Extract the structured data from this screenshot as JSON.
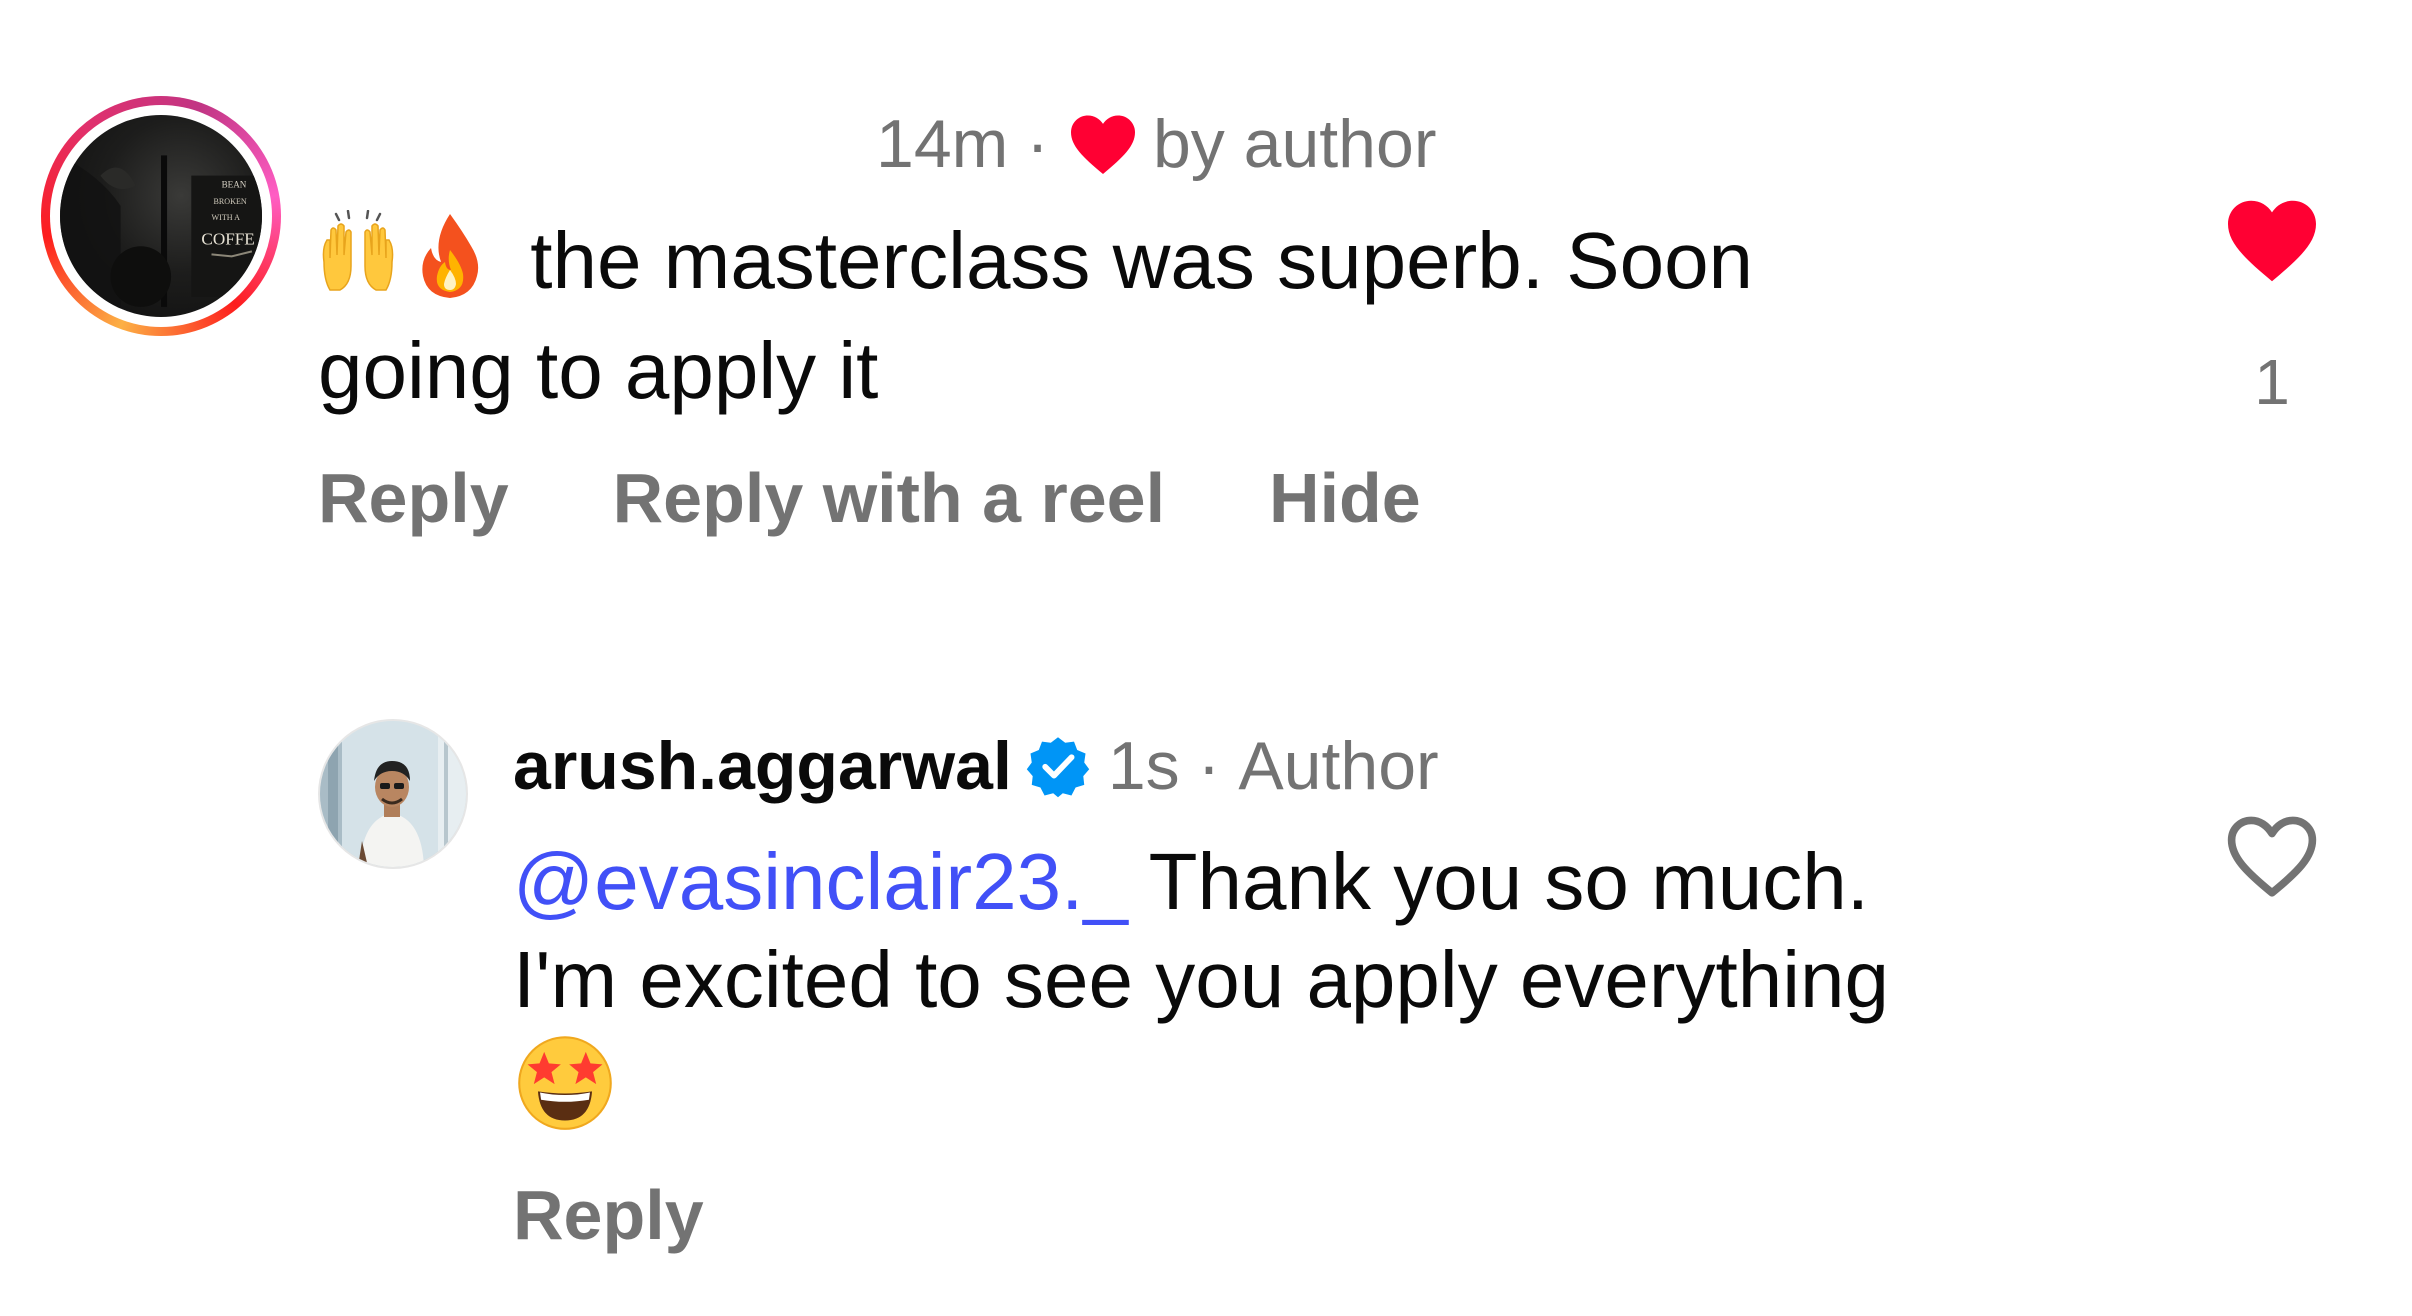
{
  "comment": {
    "commenter_avatar_alt": "avatar with coffee sign",
    "time": "14m",
    "separator": "·",
    "liked_by_author_label": "by author",
    "emoji_prefix": [
      "🙌",
      "🔥"
    ],
    "text_line1": "the masterclass was superb. Soon",
    "text_line2": "going to apply it",
    "actions": {
      "reply": "Reply",
      "reply_with_reel": "Reply with a reel",
      "hide": "Hide"
    },
    "like": {
      "liked": true,
      "count": "1",
      "icon": "heart-filled-icon",
      "color": "#ff0033"
    }
  },
  "reply": {
    "username": "arush.aggarwal",
    "verified_icon": "verified-badge-icon",
    "verified_color": "#0095f6",
    "time": "1s",
    "separator": "·",
    "role": "Author",
    "mention": "@evasinclair23._",
    "mention_color": "#4150f7",
    "text_line1": " Thank you so much.",
    "text_line2": "I'm excited to see you apply everything",
    "emoji_suffix": "🤩",
    "actions": {
      "reply": "Reply"
    },
    "like": {
      "liked": false,
      "icon": "heart-outline-icon"
    }
  },
  "colors": {
    "primary_text": "#0a0a0a",
    "secondary_text": "#737373",
    "like_red": "#ff0033"
  }
}
